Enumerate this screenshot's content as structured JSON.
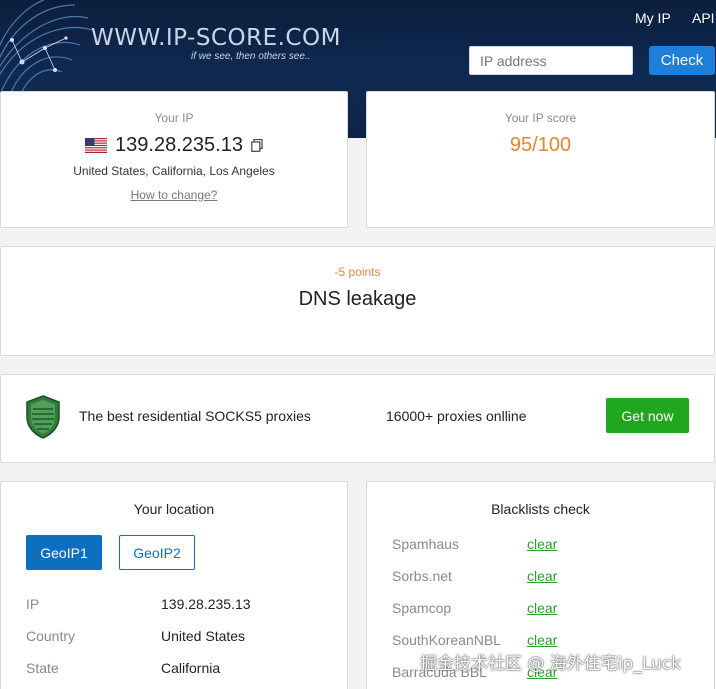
{
  "header": {
    "logo_text": "WWW.IP-SCORE.COM",
    "logo_tagline": "if we see, then others see..",
    "nav": {
      "my_ip": "My IP",
      "api": "API"
    },
    "search": {
      "placeholder": "IP address",
      "button": "Check"
    }
  },
  "your_ip": {
    "label": "Your IP",
    "ip": "139.28.235.13",
    "location": "United States, California, Los Angeles",
    "how_to_change": "How to change?"
  },
  "score": {
    "label": "Your IP score",
    "value": "95/100",
    "color": "#e8842c"
  },
  "dns": {
    "points": "-5 points",
    "title": "DNS leakage"
  },
  "ad": {
    "text": "The best residential SOCKS5 proxies",
    "count": "16000+ proxies onlline",
    "button": "Get now"
  },
  "location": {
    "title": "Your location",
    "tabs": [
      "GeoIP1",
      "GeoIP2"
    ],
    "rows": [
      {
        "label": "IP",
        "value": "139.28.235.13"
      },
      {
        "label": "Country",
        "value": "United States"
      },
      {
        "label": "State",
        "value": "California"
      }
    ]
  },
  "blacklists": {
    "title": "Blacklists check",
    "rows": [
      {
        "label": "Spamhaus",
        "value": "clear"
      },
      {
        "label": "Sorbs.net",
        "value": "clear"
      },
      {
        "label": "Spamcop",
        "value": "clear"
      },
      {
        "label": "SouthKoreanNBL",
        "value": "clear"
      },
      {
        "label": "Barracuda BBL",
        "value": "clear"
      }
    ]
  },
  "watermark": "掘金技术社区 @ 海外住宅ip_Luck",
  "colors": {
    "accent": "#1e7fd8",
    "success": "#1fa81f",
    "header_bg": "#0f2a52"
  }
}
